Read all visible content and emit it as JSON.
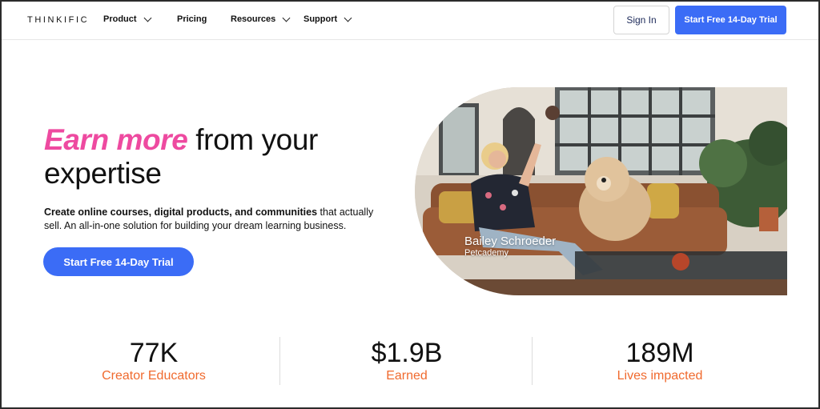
{
  "nav": {
    "logo": "THINKIFIC",
    "items": [
      {
        "label": "Product",
        "has_dropdown": true
      },
      {
        "label": "Pricing",
        "has_dropdown": false
      },
      {
        "label": "Resources",
        "has_dropdown": true
      },
      {
        "label": "Support",
        "has_dropdown": true
      }
    ],
    "sign_in": "Sign In",
    "cta": "Start Free 14-Day Trial"
  },
  "hero": {
    "headline_accent": "Earn more",
    "headline_rest_1": " from your",
    "headline_rest_2": "expertise",
    "sub_bold": "Create online courses, digital products, and communities",
    "sub_rest": " that actually sell. An all-in-one solution for building your dream learning business.",
    "cta": "Start Free 14-Day Trial",
    "caption_name": "Bailey Schroeder",
    "caption_org": "Petcademy"
  },
  "stats": [
    {
      "value": "77K",
      "label": "Creator Educators"
    },
    {
      "value": "$1.9B",
      "label": "Earned"
    },
    {
      "value": "189M",
      "label": "Lives impacted"
    }
  ],
  "colors": {
    "accent_pink": "#ee4aa0",
    "brand_blue": "#3b6cf6",
    "stat_orange": "#f06a2e"
  }
}
